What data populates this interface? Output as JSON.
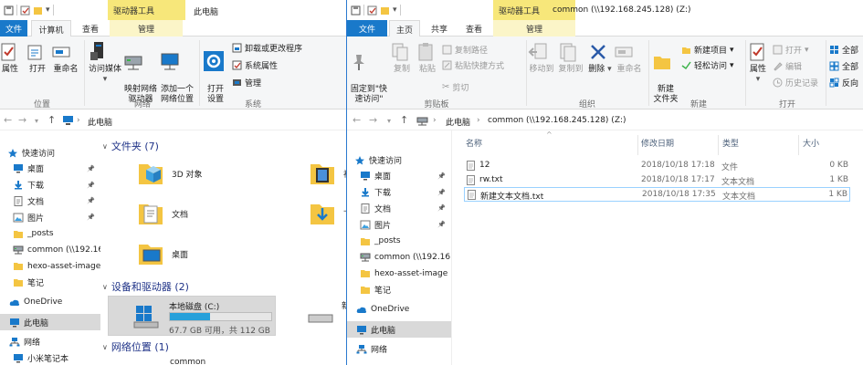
{
  "left_window": {
    "context_tab": "驱动器工具",
    "title": "此电脑",
    "tabs": [
      "文件",
      "计算机",
      "查看",
      "管理"
    ],
    "ribbon": {
      "buttons": [
        "属性",
        "打开",
        "重命名",
        "访问媒体",
        "映射网络\n驱动器",
        "添加一个\n网络位置",
        "打开\n设置"
      ],
      "small": [
        "卸载或更改程序",
        "系统属性",
        "管理"
      ],
      "groups": [
        "位置",
        "网络",
        "系统"
      ]
    },
    "breadcrumb": "此电脑",
    "nav": [
      {
        "label": "快速访问",
        "icon": "star-icon"
      },
      {
        "label": "桌面",
        "icon": "desktop-icon",
        "pinned": true
      },
      {
        "label": "下载",
        "icon": "download-icon",
        "pinned": true
      },
      {
        "label": "文档",
        "icon": "document-icon",
        "pinned": true
      },
      {
        "label": "图片",
        "icon": "picture-icon",
        "pinned": true
      },
      {
        "label": "_posts",
        "icon": "folder-icon"
      },
      {
        "label": "common (\\\\192.16",
        "icon": "network-drive-icon"
      },
      {
        "label": "hexo-asset-image",
        "icon": "folder-icon"
      },
      {
        "label": "笔记",
        "icon": "folder-icon"
      },
      {
        "label": "OneDrive",
        "icon": "cloud-icon"
      },
      {
        "label": "此电脑",
        "icon": "computer-icon"
      },
      {
        "label": "网络",
        "icon": "network-icon"
      },
      {
        "label": "小米笔记本",
        "icon": "computer-icon"
      }
    ],
    "sections": {
      "folders": "文件夹 (7)",
      "devices": "设备和驱动器 (2)",
      "network": "网络位置 (1)"
    },
    "folders": [
      "3D 对象",
      "文档",
      "桌面"
    ],
    "folders_partial": [
      "视",
      "下"
    ],
    "drive": {
      "name": "本地磁盘 (C:)",
      "space": "67.7 GB 可用，共 112 GB",
      "used_fraction": 0.4
    },
    "drive2_partial": "新",
    "network_item": "common"
  },
  "right_window": {
    "context_tab": "驱动器工具",
    "title": "common (\\\\192.168.245.128) (Z:)",
    "tabs": [
      "文件",
      "主页",
      "共享",
      "查看",
      "管理"
    ],
    "ribbon": {
      "buttons": [
        "固定到\"快\n速访问\"",
        "复制",
        "粘贴",
        "移动到",
        "复制到",
        "删除",
        "重命名",
        "新建\n文件夹",
        "属性"
      ],
      "small": [
        "复制路径",
        "粘贴快捷方式",
        "剪切",
        "新建项目",
        "轻松访问",
        "打开",
        "编辑",
        "历史记录",
        "全部",
        "全部",
        "反向"
      ],
      "groups": [
        "剪贴板",
        "组织",
        "新建",
        "打开"
      ]
    },
    "breadcrumb": [
      "此电脑",
      "common (\\\\192.168.245.128) (Z:)"
    ],
    "nav": [
      {
        "label": "快速访问",
        "icon": "star-icon"
      },
      {
        "label": "桌面",
        "icon": "desktop-icon",
        "pinned": true
      },
      {
        "label": "下载",
        "icon": "download-icon",
        "pinned": true
      },
      {
        "label": "文档",
        "icon": "document-icon",
        "pinned": true
      },
      {
        "label": "图片",
        "icon": "picture-icon",
        "pinned": true
      },
      {
        "label": "_posts",
        "icon": "folder-icon"
      },
      {
        "label": "common (\\\\192.16",
        "icon": "network-drive-icon"
      },
      {
        "label": "hexo-asset-image",
        "icon": "folder-icon"
      },
      {
        "label": "笔记",
        "icon": "folder-icon"
      },
      {
        "label": "OneDrive",
        "icon": "cloud-icon"
      },
      {
        "label": "此电脑",
        "icon": "computer-icon"
      },
      {
        "label": "网络",
        "icon": "network-icon"
      }
    ],
    "columns": [
      "名称",
      "修改日期",
      "类型",
      "大小"
    ],
    "files": [
      {
        "name": "12",
        "date": "2018/10/18 17:18",
        "type": "文件",
        "size": "0 KB"
      },
      {
        "name": "rw.txt",
        "date": "2018/10/18 17:17",
        "type": "文本文档",
        "size": "1 KB"
      },
      {
        "name": "新建文本文档.txt",
        "date": "2018/10/18 17:35",
        "type": "文本文档",
        "size": "1 KB"
      }
    ]
  },
  "colors": {
    "accent": "#1979ca",
    "context": "#f7e77a",
    "folder": "#f4c542",
    "selection": "#d9d9d9"
  }
}
